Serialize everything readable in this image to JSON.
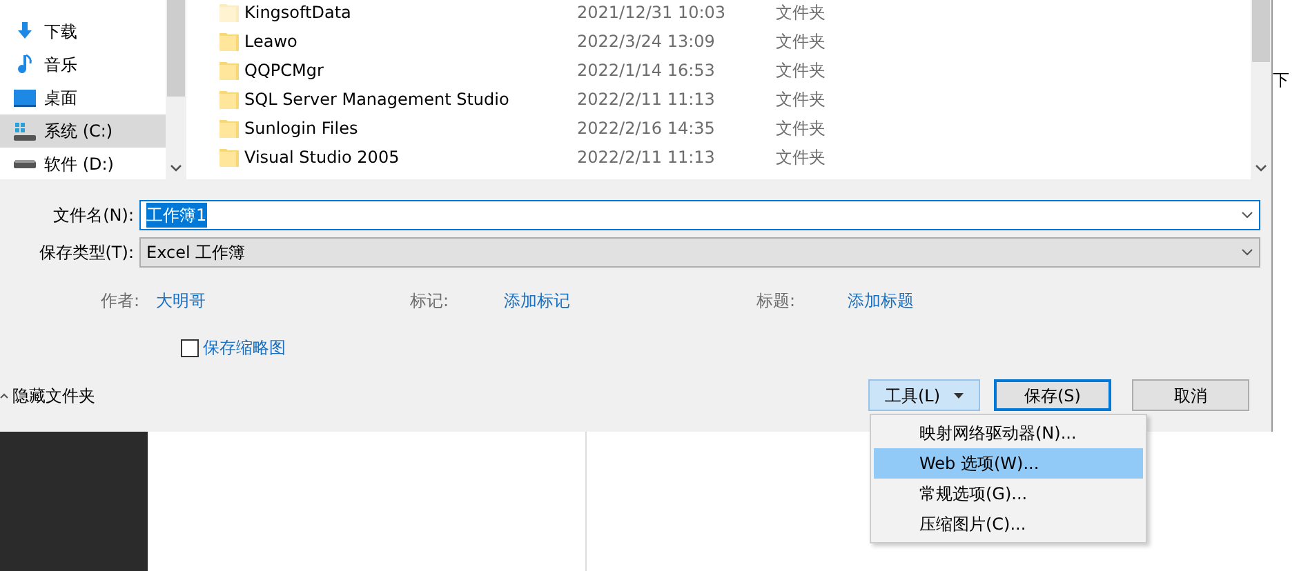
{
  "nav_items": [
    {
      "label": "下载",
      "kind": "download",
      "selected": false
    },
    {
      "label": "音乐",
      "kind": "music",
      "selected": false
    },
    {
      "label": "桌面",
      "kind": "desktop",
      "selected": false
    },
    {
      "label": "系统 (C:)",
      "kind": "system-drive",
      "selected": true
    },
    {
      "label": "软件 (D:)",
      "kind": "drive",
      "selected": false
    }
  ],
  "files": [
    {
      "name": "KingsoftData",
      "modified": "2021/12/31 10:03",
      "type": "文件夹",
      "hidden": true
    },
    {
      "name": "Leawo",
      "modified": "2022/3/24 13:09",
      "type": "文件夹",
      "hidden": false
    },
    {
      "name": "QQPCMgr",
      "modified": "2022/1/14 16:53",
      "type": "文件夹",
      "hidden": false
    },
    {
      "name": "SQL Server Management Studio",
      "modified": "2022/2/11 11:13",
      "type": "文件夹",
      "hidden": false
    },
    {
      "name": "Sunlogin Files",
      "modified": "2022/2/16 14:35",
      "type": "文件夹",
      "hidden": false
    },
    {
      "name": "Visual Studio 2005",
      "modified": "2022/2/11 11:13",
      "type": "文件夹",
      "hidden": false
    }
  ],
  "file_name": {
    "label": "文件名(N):",
    "value": "工作簿1",
    "selected": true
  },
  "save_type": {
    "label": "保存类型(T):",
    "value": "Excel 工作簿"
  },
  "metadata": [
    {
      "label": "作者:",
      "value": "大明哥"
    },
    {
      "label": "标记:",
      "value": "添加标记"
    },
    {
      "label": "标题:",
      "value": "添加标题"
    }
  ],
  "thumbnail_checkbox": {
    "label": "保存缩略图",
    "checked": false
  },
  "hide_folders": {
    "label": "隐藏文件夹"
  },
  "buttons": [
    {
      "label": "工具(L)",
      "kind": "dropdown"
    },
    {
      "label": "保存(S)",
      "kind": "default"
    },
    {
      "label": "取消",
      "kind": "plain"
    }
  ],
  "tools_menu": [
    {
      "label": "映射网络驱动器(N)...",
      "selected": false
    },
    {
      "label": "Web 选项(W)...",
      "selected": true
    },
    {
      "label": "常规选项(G)...",
      "selected": false
    },
    {
      "label": "压缩图片(C)...",
      "selected": false
    }
  ],
  "background_text": "下"
}
